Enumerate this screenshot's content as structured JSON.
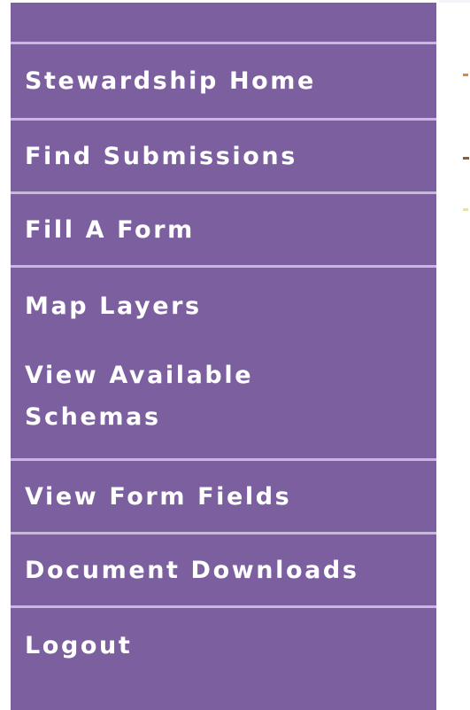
{
  "nav": {
    "items": [
      {
        "label": "Stewardship Home"
      },
      {
        "label": "Find Submissions"
      },
      {
        "label": "Fill A Form"
      },
      {
        "label": "Map Layers"
      },
      {
        "label": "View Available Schemas"
      },
      {
        "label": "View Form Fields"
      },
      {
        "label": "Document Downloads"
      },
      {
        "label": "Logout"
      }
    ]
  },
  "colors": {
    "sidebar_bg": "#7b5f9e",
    "divider": "#c8b8dc",
    "nav_text": "#ffffff"
  }
}
